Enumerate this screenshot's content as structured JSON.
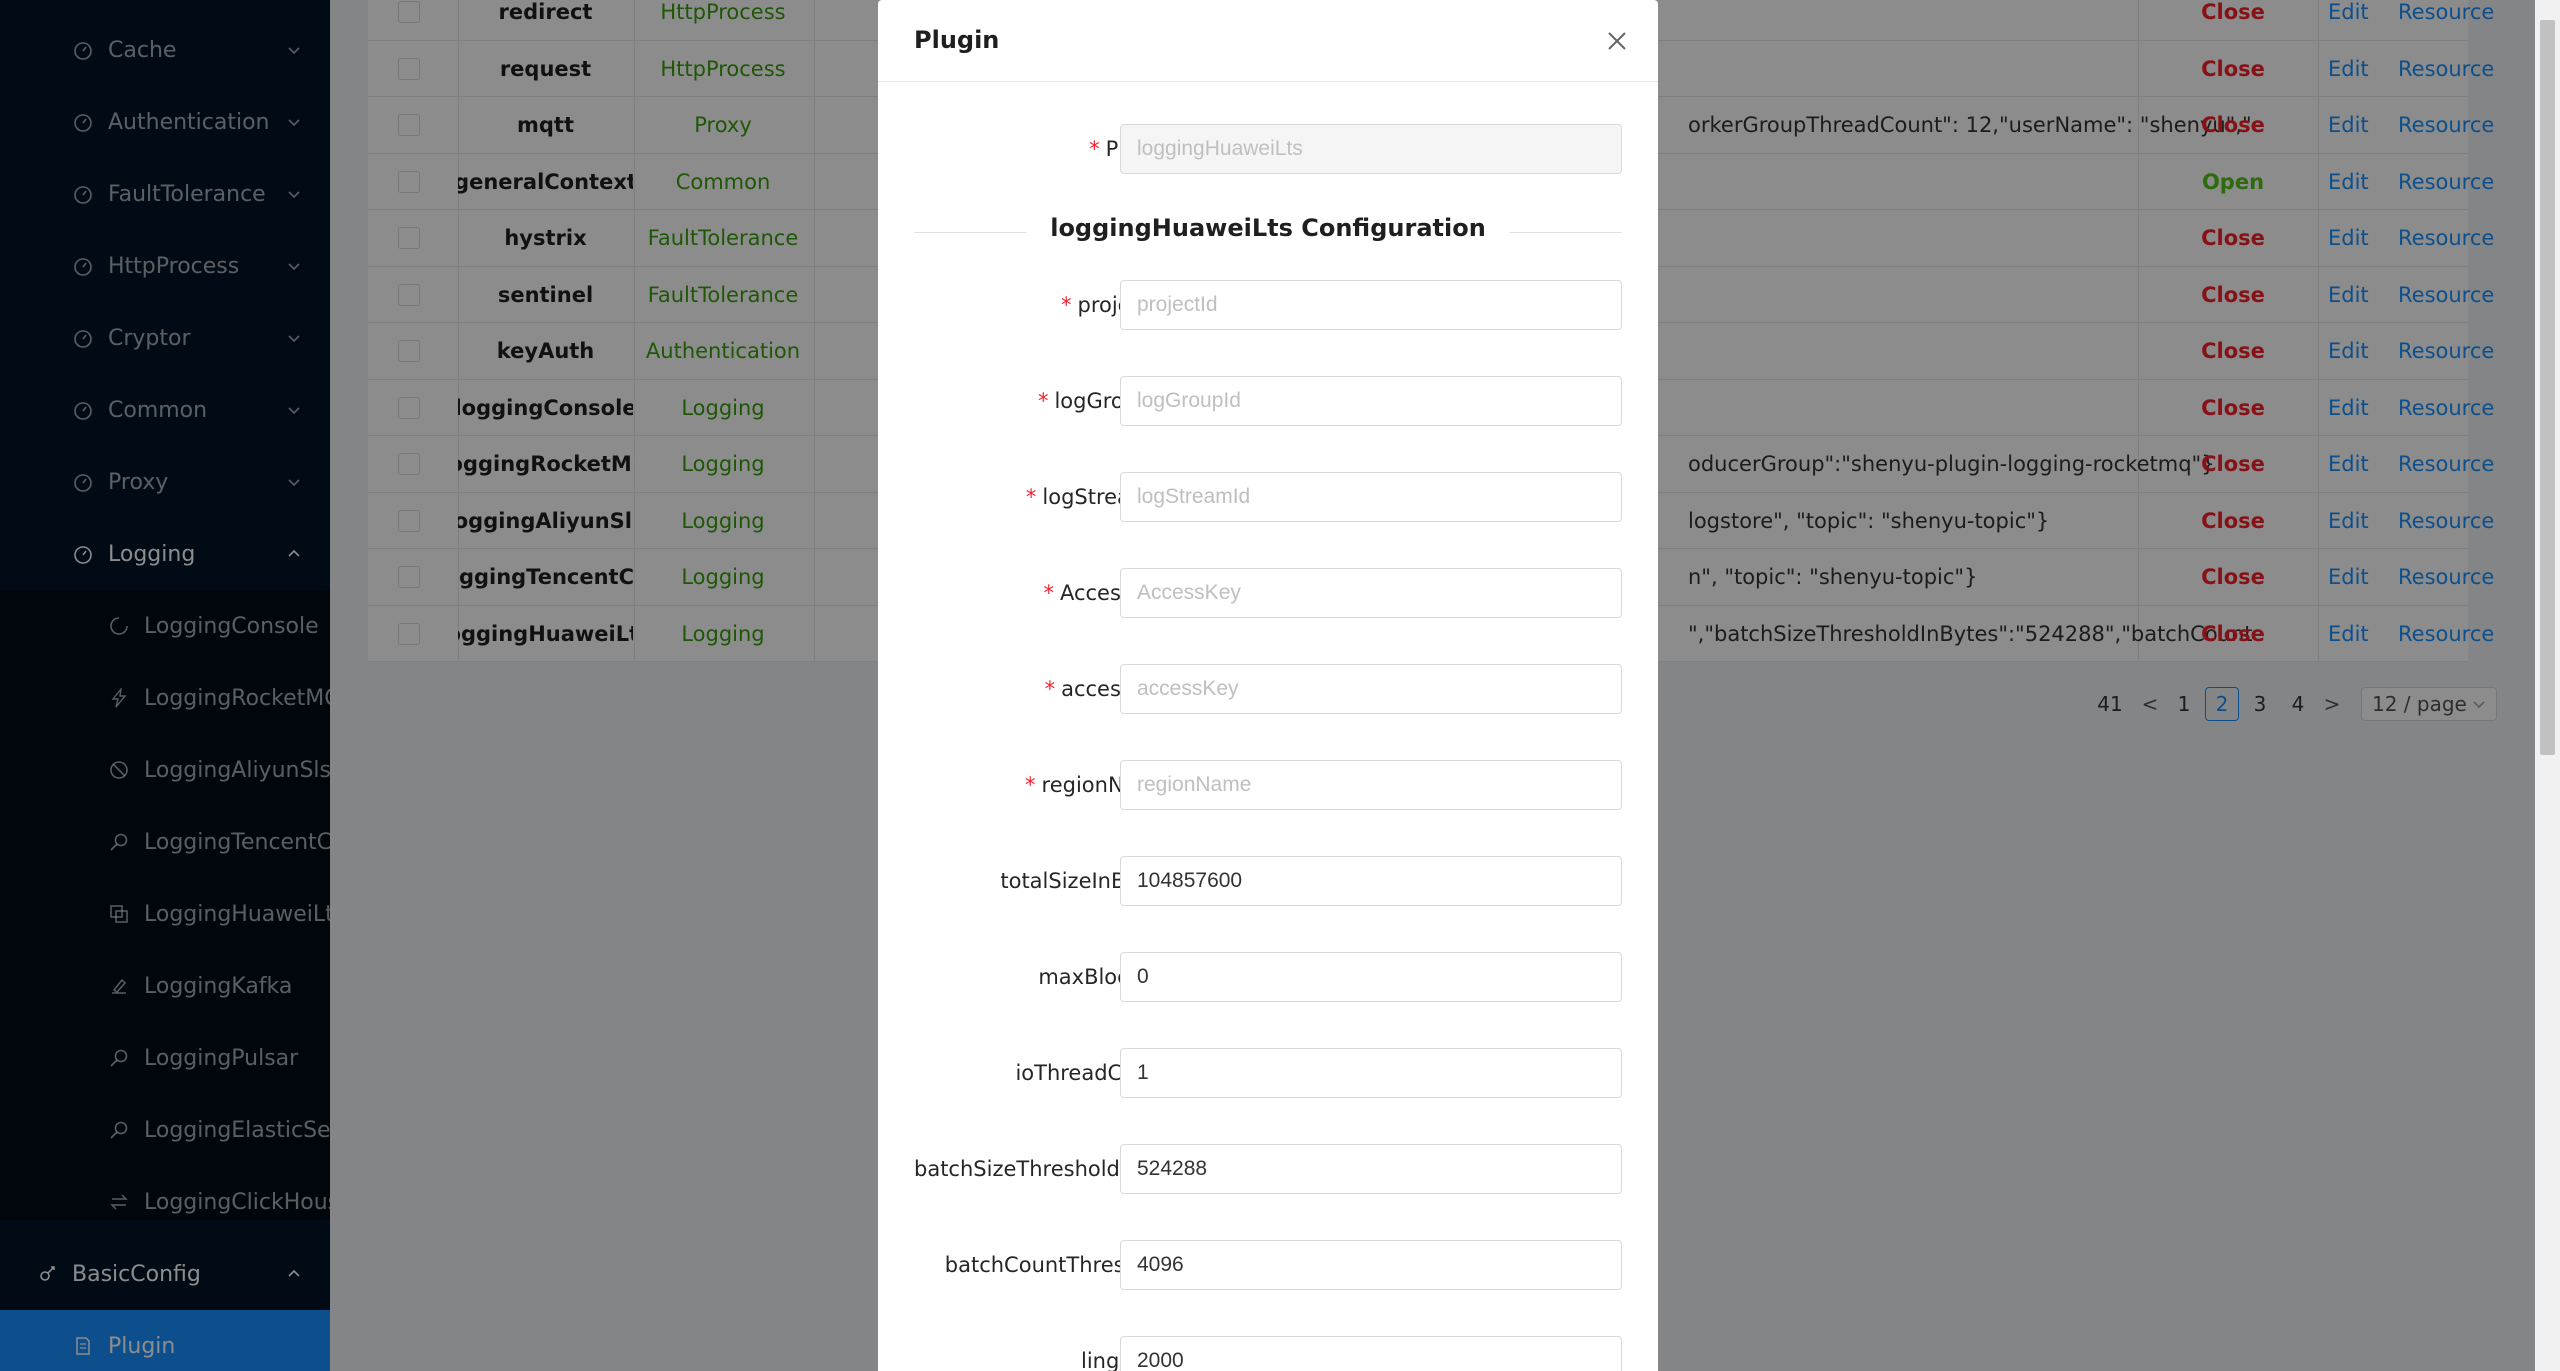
{
  "sidebar": {
    "items": [
      {
        "label": "Cache",
        "icon": "dashboard-icon",
        "type": "group"
      },
      {
        "label": "Authentication",
        "icon": "dashboard-icon",
        "type": "group"
      },
      {
        "label": "FaultTolerance",
        "icon": "dashboard-icon",
        "type": "group"
      },
      {
        "label": "HttpProcess",
        "icon": "dashboard-icon",
        "type": "group"
      },
      {
        "label": "Cryptor",
        "icon": "dashboard-icon",
        "type": "group"
      },
      {
        "label": "Common",
        "icon": "dashboard-icon",
        "type": "group"
      },
      {
        "label": "Proxy",
        "icon": "dashboard-icon",
        "type": "group"
      },
      {
        "label": "Logging",
        "icon": "dashboard-icon",
        "type": "group-open"
      },
      {
        "label": "LoggingConsole",
        "icon": "loading-icon",
        "type": "sub"
      },
      {
        "label": "LoggingRocketMQ",
        "icon": "thunderbolt-icon",
        "type": "sub"
      },
      {
        "label": "LoggingAliyunSls",
        "icon": "stop-icon",
        "type": "sub"
      },
      {
        "label": "LoggingTencentCls",
        "icon": "search-icon",
        "type": "sub"
      },
      {
        "label": "LoggingHuaweiLts",
        "icon": "copy-icon",
        "type": "sub"
      },
      {
        "label": "LoggingKafka",
        "icon": "highlight-icon",
        "type": "sub"
      },
      {
        "label": "LoggingPulsar",
        "icon": "search-icon",
        "type": "sub"
      },
      {
        "label": "LoggingElasticSearch",
        "icon": "search-icon",
        "type": "sub"
      },
      {
        "label": "LoggingClickHouse",
        "icon": "swap-icon",
        "type": "sub"
      },
      {
        "label": "BasicConfig",
        "icon": "api-icon",
        "type": "top-open"
      },
      {
        "label": "Plugin",
        "icon": "file-icon",
        "type": "selected"
      }
    ]
  },
  "table": {
    "rows": [
      {
        "name": "redirect",
        "role": "HttpProcess",
        "config": "",
        "status": "Close",
        "edit": "Edit",
        "resource": "Resource"
      },
      {
        "name": "request",
        "role": "HttpProcess",
        "config": "",
        "status": "Close",
        "edit": "Edit",
        "resource": "Resource"
      },
      {
        "name": "mqtt",
        "role": "Proxy",
        "config": "orkerGroupThreadCount\": 12,\"userName\": \"shenyu\",\"",
        "status": "Close",
        "edit": "Edit",
        "resource": "Resource"
      },
      {
        "name": "generalContext",
        "role": "Common",
        "config": "",
        "status": "Open",
        "edit": "Edit",
        "resource": "Resource"
      },
      {
        "name": "hystrix",
        "role": "FaultTolerance",
        "config": "",
        "status": "Close",
        "edit": "Edit",
        "resource": "Resource"
      },
      {
        "name": "sentinel",
        "role": "FaultTolerance",
        "config": "",
        "status": "Close",
        "edit": "Edit",
        "resource": "Resource"
      },
      {
        "name": "keyAuth",
        "role": "Authentication",
        "config": "",
        "status": "Close",
        "edit": "Edit",
        "resource": "Resource"
      },
      {
        "name": "loggingConsole",
        "role": "Logging",
        "config": "",
        "status": "Close",
        "edit": "Edit",
        "resource": "Resource"
      },
      {
        "name": "loggingRocketMQ",
        "role": "Logging",
        "config": "oducerGroup\":\"shenyu-plugin-logging-rocketmq\"}",
        "status": "Close",
        "edit": "Edit",
        "resource": "Resource"
      },
      {
        "name": "loggingAliyunSls",
        "role": "Logging",
        "config": "logstore\", \"topic\": \"shenyu-topic\"}",
        "status": "Close",
        "edit": "Edit",
        "resource": "Resource"
      },
      {
        "name": "loggingTencentCls",
        "role": "Logging",
        "config": "n\", \"topic\": \"shenyu-topic\"}",
        "status": "Close",
        "edit": "Edit",
        "resource": "Resource"
      },
      {
        "name": "loggingHuaweiLts",
        "role": "Logging",
        "config": "\",\"batchSizeThresholdInBytes\":\"524288\",\"batchCount",
        "status": "Close",
        "edit": "Edit",
        "resource": "Resource"
      }
    ]
  },
  "pagination": {
    "total": "41",
    "prev": "<",
    "next": ">",
    "pages": [
      "1",
      "2",
      "3",
      "4"
    ],
    "current": "2",
    "page_size": "12 / page"
  },
  "modal": {
    "title": "Plugin",
    "section_title": "loggingHuaweiLts Configuration",
    "fields": [
      {
        "label": "Plugin",
        "required": true,
        "value": "",
        "placeholder": "loggingHuaweiLts",
        "disabled": true
      },
      {
        "label": "projectId",
        "required": true,
        "value": "",
        "placeholder": "projectId"
      },
      {
        "label": "logGroupId",
        "required": true,
        "value": "",
        "placeholder": "logGroupId"
      },
      {
        "label": "logStreamId",
        "required": true,
        "value": "",
        "placeholder": "logStreamId"
      },
      {
        "label": "AccessKey",
        "required": true,
        "value": "",
        "placeholder": "AccessKey"
      },
      {
        "label": "accessKey",
        "required": true,
        "value": "",
        "placeholder": "accessKey"
      },
      {
        "label": "regionName",
        "required": true,
        "value": "",
        "placeholder": "regionName"
      },
      {
        "label": "totalSizeInBytes",
        "required": false,
        "value": "104857600",
        "placeholder": ""
      },
      {
        "label": "maxBlockMs",
        "required": false,
        "value": "0",
        "placeholder": ""
      },
      {
        "label": "ioThreadCount",
        "required": false,
        "value": "1",
        "placeholder": ""
      },
      {
        "label": "batchSizeThresholdInBytes",
        "required": false,
        "value": "524288",
        "placeholder": "",
        "truncated": true
      },
      {
        "label": "batchCountThreshold",
        "required": false,
        "value": "4096",
        "placeholder": ""
      },
      {
        "label": "lingerMs",
        "required": false,
        "value": "2000",
        "placeholder": ""
      }
    ]
  },
  "colors": {
    "sidebar_bg": "#001529",
    "selected": "#1890ff",
    "open": "#52c41a",
    "close": "#f5222d",
    "link": "#1890ff"
  }
}
